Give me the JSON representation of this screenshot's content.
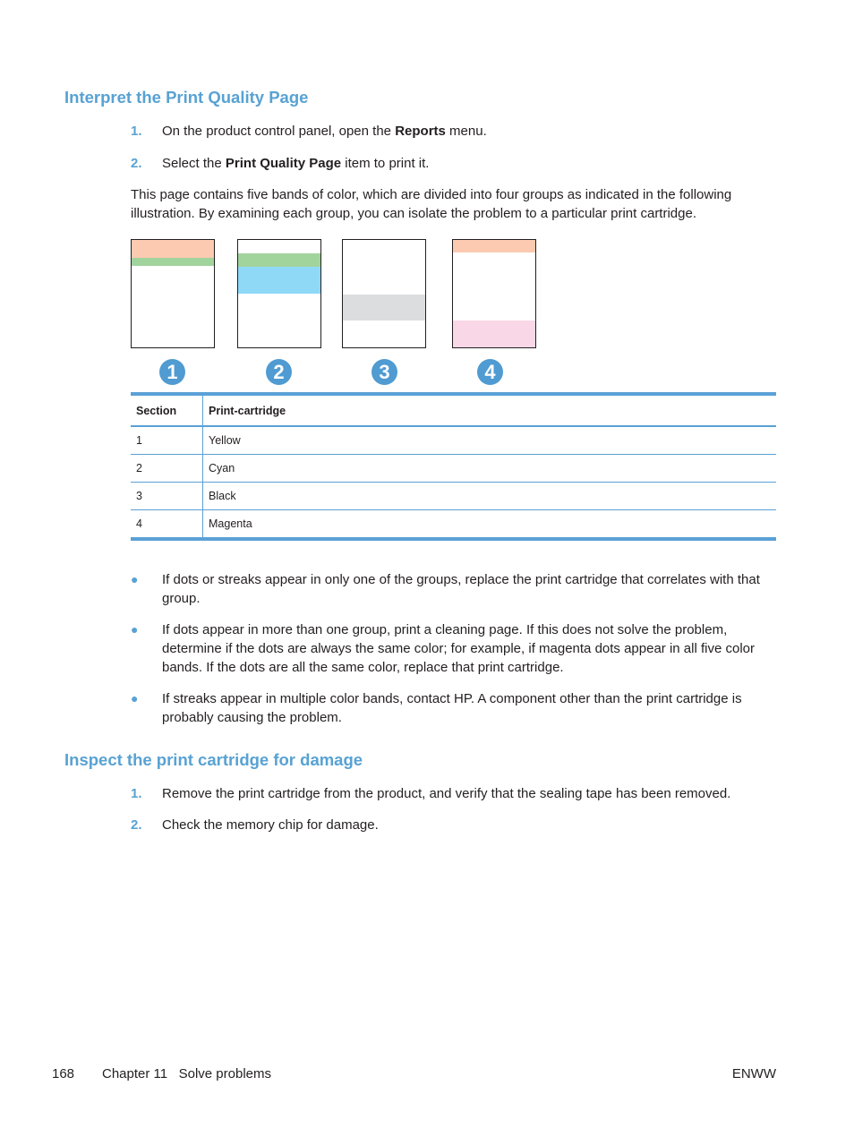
{
  "section1": {
    "heading": "Interpret the Print Quality Page",
    "steps": [
      {
        "num": "1.",
        "pre": "On the product control panel, open the ",
        "bold": "Reports",
        "post": " menu."
      },
      {
        "num": "2.",
        "pre": "Select the ",
        "bold": "Print Quality Page",
        "post": " item to print it."
      }
    ],
    "intro": "This page contains five bands of color, which are divided into four groups as indicated in the following illustration. By examining each group, you can isolate the problem to a particular print cartridge."
  },
  "illustration": {
    "badges": [
      "1",
      "2",
      "3",
      "4"
    ],
    "colors": {
      "yellow_band": "#fbcab0",
      "green_band": "#a1d39c",
      "cyan_band": "#8fd9f7",
      "black_band": "#dcdddf",
      "magenta_band": "#f9d7e6",
      "badge": "#4f9bd2"
    }
  },
  "table": {
    "headers": [
      "Section",
      "Print-cartridge"
    ],
    "rows": [
      [
        "1",
        "Yellow"
      ],
      [
        "2",
        "Cyan"
      ],
      [
        "3",
        "Black"
      ],
      [
        "4",
        "Magenta"
      ]
    ]
  },
  "bullets": [
    "If dots or streaks appear in only one of the groups, replace the print cartridge that correlates with that group.",
    "If dots appear in more than one group, print a cleaning page. If this does not solve the problem, determine if the dots are always the same color; for example, if magenta dots appear in all five color bands. If the dots are all the same color, replace that print cartridge.",
    "If streaks appear in multiple color bands, contact HP. A component other than the print cartridge is probably causing the problem."
  ],
  "section2": {
    "heading": "Inspect the print cartridge for damage",
    "steps": [
      {
        "num": "1.",
        "text": "Remove the print cartridge from the product, and verify that the sealing tape has been removed."
      },
      {
        "num": "2.",
        "text": "Check the memory chip for damage."
      }
    ]
  },
  "footer": {
    "page_number": "168",
    "chapter": "Chapter 11   Solve problems",
    "right": "ENWW"
  },
  "accent_color": "#58a2d3"
}
